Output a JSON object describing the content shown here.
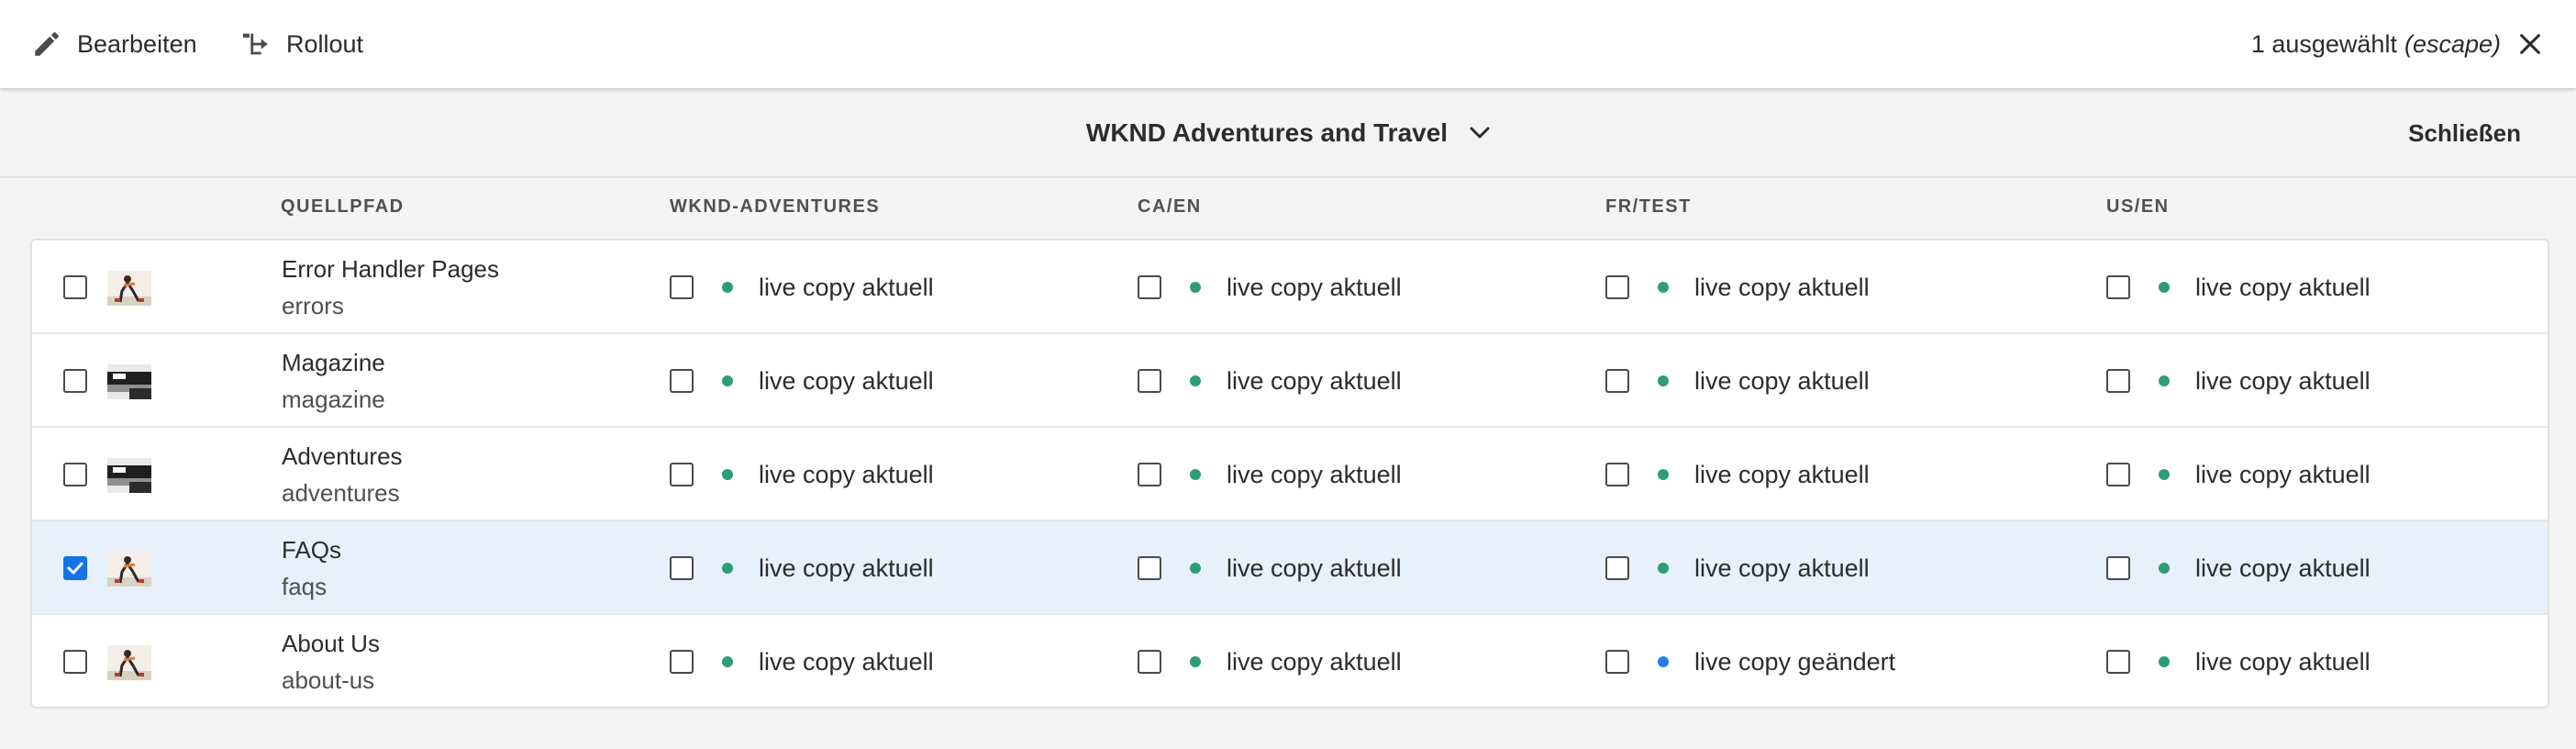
{
  "actionbar": {
    "edit_label": "Bearbeiten",
    "rollout_label": "Rollout",
    "selection_count": "1 ausgewählt",
    "escape_hint": "(escape)"
  },
  "header": {
    "title": "WKND Adventures and Travel",
    "close_label": "Schließen"
  },
  "columns": [
    "QUELLPFAD",
    "WKND-ADVENTURES",
    "CA/EN",
    "FR/TEST",
    "US/EN"
  ],
  "rows": [
    {
      "name": "Error Handler Pages",
      "path": "errors",
      "checked": false,
      "thumb": "person-icon",
      "statuses": [
        {
          "text": "live copy aktuell",
          "state": "current"
        },
        {
          "text": "live copy aktuell",
          "state": "current"
        },
        {
          "text": "live copy aktuell",
          "state": "current"
        },
        {
          "text": "live copy aktuell",
          "state": "current"
        }
      ]
    },
    {
      "name": "Magazine",
      "path": "magazine",
      "checked": false,
      "thumb": "landscape-icon",
      "statuses": [
        {
          "text": "live copy aktuell",
          "state": "current"
        },
        {
          "text": "live copy aktuell",
          "state": "current"
        },
        {
          "text": "live copy aktuell",
          "state": "current"
        },
        {
          "text": "live copy aktuell",
          "state": "current"
        }
      ]
    },
    {
      "name": "Adventures",
      "path": "adventures",
      "checked": false,
      "thumb": "landscape-icon",
      "statuses": [
        {
          "text": "live copy aktuell",
          "state": "current"
        },
        {
          "text": "live copy aktuell",
          "state": "current"
        },
        {
          "text": "live copy aktuell",
          "state": "current"
        },
        {
          "text": "live copy aktuell",
          "state": "current"
        }
      ]
    },
    {
      "name": "FAQs",
      "path": "faqs",
      "checked": true,
      "thumb": "person-icon",
      "statuses": [
        {
          "text": "live copy aktuell",
          "state": "current"
        },
        {
          "text": "live copy aktuell",
          "state": "current"
        },
        {
          "text": "live copy aktuell",
          "state": "current"
        },
        {
          "text": "live copy aktuell",
          "state": "current"
        }
      ]
    },
    {
      "name": "About Us",
      "path": "about-us",
      "checked": false,
      "thumb": "person-icon",
      "statuses": [
        {
          "text": "live copy aktuell",
          "state": "current"
        },
        {
          "text": "live copy aktuell",
          "state": "current"
        },
        {
          "text": "live copy geändert",
          "state": "changed"
        },
        {
          "text": "live copy aktuell",
          "state": "current"
        }
      ]
    }
  ],
  "colors": {
    "status_current": "#2d9d78",
    "status_changed": "#2680eb",
    "selected_row": "#e8f0fb",
    "accent": "#1473e6"
  }
}
